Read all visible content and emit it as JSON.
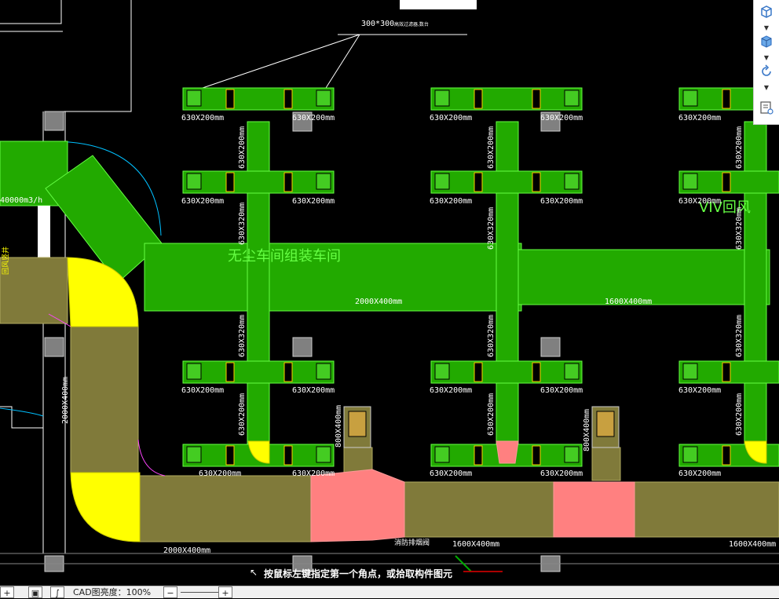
{
  "drawing": {
    "annotation_top": "300*300",
    "annotation_top_suffix": "高效过滤器,数台",
    "room_label": "无尘车间组装车间",
    "flow_label": "40000m3/h",
    "side_label": "回风竖井",
    "main_duct_left": "2000X400mm",
    "main_duct_right": "1600X400mm",
    "lower_duct_left": "2000X400mm",
    "lower_duct_mid": "1600X400mm",
    "lower_duct_right": "1600X400mm",
    "vertical_duct_left": "2000X400mm",
    "branch_630x200": "630X200mm",
    "branch_630x320": "630X320mm",
    "riser_800x400": "800X400mm",
    "fire_damper": "消防排烟阀",
    "right_overlay": "VIV回风"
  },
  "toolbar": {
    "items": [
      {
        "name": "view-cube-icon"
      },
      {
        "name": "shaded-cube-icon"
      },
      {
        "name": "rotate-icon"
      },
      {
        "name": "properties-icon"
      }
    ]
  },
  "command": {
    "prompt": "按鼠标左键指定第一个角点，或拾取构件图元"
  },
  "status": {
    "cad_height_label": "CAD图亮度：100%",
    "zoom_minus": "−",
    "zoom_plus": "+"
  },
  "colors": {
    "duct_green": "#22aa00",
    "duct_olive": "#807a3a",
    "elbow_yellow": "#ffff00",
    "fitting_pink": "#ff8080",
    "grey_block": "#808080"
  }
}
